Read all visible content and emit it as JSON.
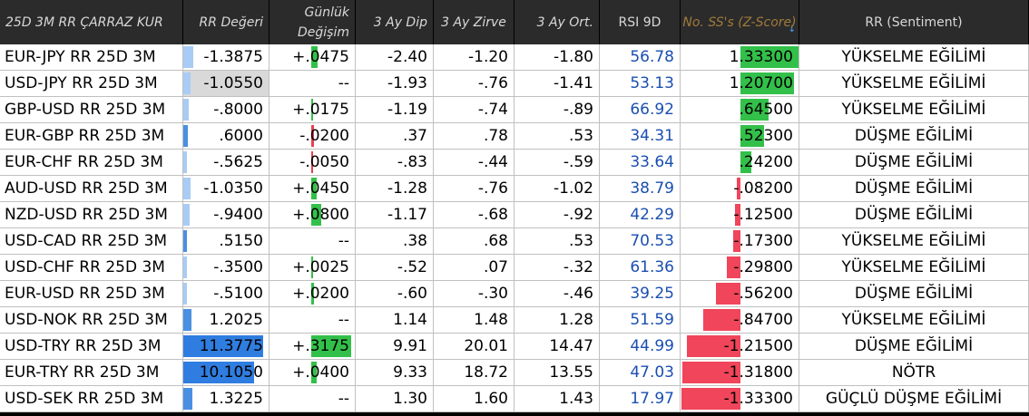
{
  "columns": [
    {
      "key": "pair",
      "label": "25D 3M RR ÇARRAZ KUR"
    },
    {
      "key": "rr",
      "label": "RR Değeri"
    },
    {
      "key": "chg",
      "label": "Günlük Değişim"
    },
    {
      "key": "low",
      "label": "3 Ay Dip"
    },
    {
      "key": "high",
      "label": "3 Ay Zirve"
    },
    {
      "key": "avg",
      "label": "3 Ay Ort."
    },
    {
      "key": "rsi",
      "label": "RSI 9D"
    },
    {
      "key": "z",
      "label": "No. SS's (Z-Score)"
    },
    {
      "key": "sent",
      "label": "RR (Sentiment)"
    }
  ],
  "sort_icon": "sort-descending-icon",
  "colors": {
    "rr_bar": "#4a90e2",
    "rr_bar_light": "#a8ccf5",
    "rr_bar_selected": "#2f7de0",
    "chg_bar": "#33c04a",
    "chg_bar_neg": "#e8414f",
    "z_pos": "#33c04a",
    "z_neg": "#f0455a",
    "rsi": "#1a4fb0"
  },
  "rows": [
    {
      "pair": "EUR-JPY RR 25D 3M",
      "rr": "-1.3875",
      "rr_v": -1.3875,
      "chg": "+.0475",
      "chg_v": 0.0475,
      "low": "-2.40",
      "high": "-1.20",
      "avg": "-1.80",
      "rsi": "56.78",
      "z": "1.33300",
      "z_v": 1.333,
      "sent": "YÜKSELME EĞİLİMİ"
    },
    {
      "pair": "USD-JPY RR 25D 3M",
      "rr": "-1.0550",
      "rr_v": -1.055,
      "chg": "--",
      "chg_v": 0,
      "low": "-1.93",
      "high": "-.76",
      "avg": "-1.41",
      "rsi": "53.13",
      "z": "1.20700",
      "z_v": 1.207,
      "sent": "YÜKSELME EĞİLİMİ",
      "selected": true
    },
    {
      "pair": "GBP-USD RR 25D 3M",
      "rr": "-.8000",
      "rr_v": -0.8,
      "chg": "+.0175",
      "chg_v": 0.0175,
      "low": "-1.19",
      "high": "-.74",
      "avg": "-.89",
      "rsi": "66.92",
      "z": ".64500",
      "z_v": 0.645,
      "sent": "YÜKSELME EĞİLİMİ"
    },
    {
      "pair": "EUR-GBP RR 25D 3M",
      "rr": ".6000",
      "rr_v": 0.6,
      "chg": "-.0200",
      "chg_v": -0.02,
      "low": ".37",
      "high": ".78",
      "avg": ".53",
      "rsi": "34.31",
      "z": ".52300",
      "z_v": 0.523,
      "sent": "DÜŞME EĞİLİMİ"
    },
    {
      "pair": "EUR-CHF RR 25D 3M",
      "rr": "-.5625",
      "rr_v": -0.5625,
      "chg": "-.0050",
      "chg_v": -0.005,
      "low": "-.83",
      "high": "-.44",
      "avg": "-.59",
      "rsi": "33.64",
      "z": ".24200",
      "z_v": 0.242,
      "sent": "DÜŞME EĞİLİMİ"
    },
    {
      "pair": "AUD-USD RR 25D 3M",
      "rr": "-1.0350",
      "rr_v": -1.035,
      "chg": "+.0450",
      "chg_v": 0.045,
      "low": "-1.28",
      "high": "-.76",
      "avg": "-1.02",
      "rsi": "38.79",
      "z": "-.08200",
      "z_v": -0.082,
      "sent": "DÜŞME EĞİLİMİ"
    },
    {
      "pair": "NZD-USD RR 25D 3M",
      "rr": "-.9400",
      "rr_v": -0.94,
      "chg": "+.0800",
      "chg_v": 0.08,
      "low": "-1.17",
      "high": "-.68",
      "avg": "-.92",
      "rsi": "42.29",
      "z": "-.12500",
      "z_v": -0.125,
      "sent": "DÜŞME EĞİLİMİ"
    },
    {
      "pair": "USD-CAD RR 25D 3M",
      "rr": ".5150",
      "rr_v": 0.515,
      "chg": "--",
      "chg_v": 0,
      "low": ".38",
      "high": ".68",
      "avg": ".53",
      "rsi": "70.53",
      "z": "-.17300",
      "z_v": -0.173,
      "sent": "YÜKSELME EĞİLİMİ"
    },
    {
      "pair": "USD-CHF RR 25D 3M",
      "rr": "-.3500",
      "rr_v": -0.35,
      "chg": "+.0025",
      "chg_v": 0.0025,
      "low": "-.52",
      "high": ".07",
      "avg": "-.32",
      "rsi": "61.36",
      "z": "-.29800",
      "z_v": -0.298,
      "sent": "YÜKSELME EĞİLİMİ"
    },
    {
      "pair": "EUR-USD RR 25D 3M",
      "rr": "-.5100",
      "rr_v": -0.51,
      "chg": "+.0200",
      "chg_v": 0.02,
      "low": "-.60",
      "high": "-.30",
      "avg": "-.46",
      "rsi": "39.25",
      "z": "-.56200",
      "z_v": -0.562,
      "sent": "DÜŞME EĞİLİMİ"
    },
    {
      "pair": "USD-NOK RR 25D 3M",
      "rr": "1.2025",
      "rr_v": 1.2025,
      "chg": "--",
      "chg_v": 0,
      "low": "1.14",
      "high": "1.48",
      "avg": "1.28",
      "rsi": "51.59",
      "z": "-.84700",
      "z_v": -0.847,
      "sent": "YÜKSELME EĞİLİMİ"
    },
    {
      "pair": "USD-TRY RR 25D 3M",
      "rr": "11.3775",
      "rr_v": 11.3775,
      "chg": "+.3175",
      "chg_v": 0.3175,
      "low": "9.91",
      "high": "20.01",
      "avg": "14.47",
      "rsi": "44.99",
      "z": "-1.21500",
      "z_v": -1.215,
      "sent": "DÜŞME EĞİLİMİ"
    },
    {
      "pair": "EUR-TRY RR 25D 3M",
      "rr": "10.1050",
      "rr_v": 10.105,
      "chg": "+.0400",
      "chg_v": 0.04,
      "low": "9.33",
      "high": "18.72",
      "avg": "13.55",
      "rsi": "47.03",
      "z": "-1.31800",
      "z_v": -1.318,
      "sent": "NÖTR"
    },
    {
      "pair": "USD-SEK RR 25D 3M",
      "rr": "1.3225",
      "rr_v": 1.3225,
      "chg": "--",
      "chg_v": 0,
      "low": "1.30",
      "high": "1.60",
      "avg": "1.43",
      "rsi": "17.97",
      "z": "-1.33300",
      "z_v": -1.333,
      "sent": "GÜÇLÜ DÜŞME EĞİLİMİ"
    }
  ]
}
